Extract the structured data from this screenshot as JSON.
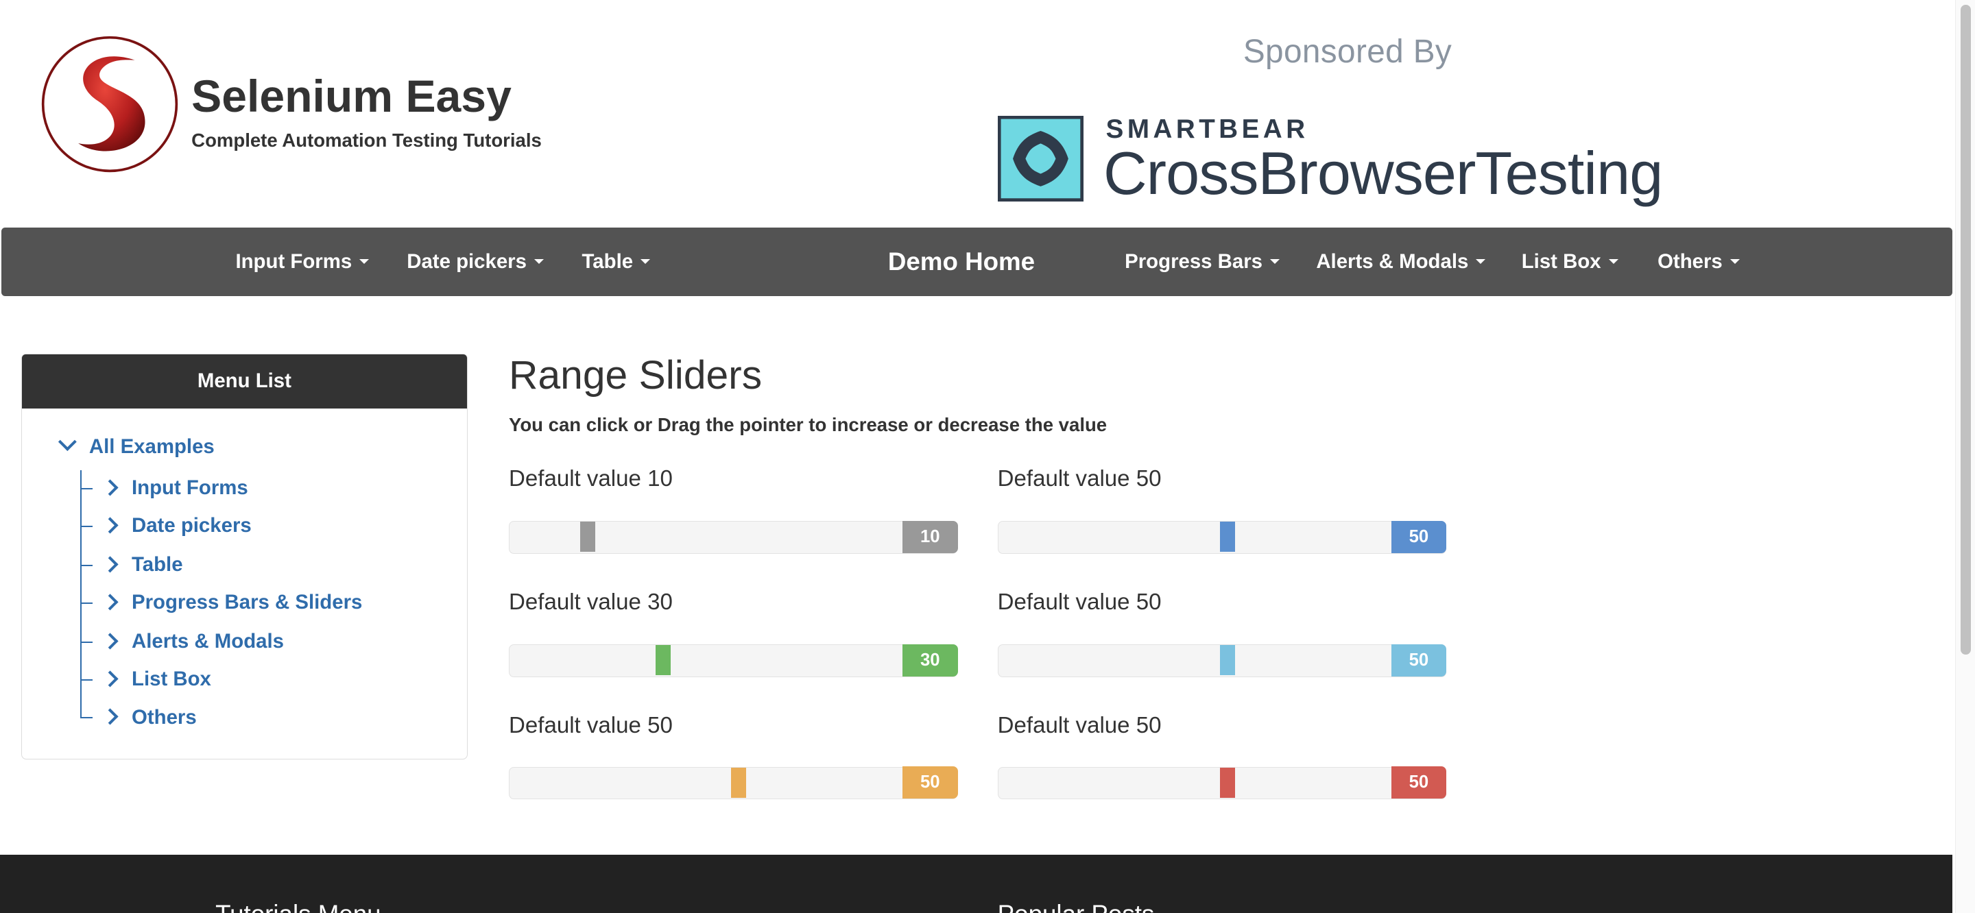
{
  "header": {
    "brand_title": "Selenium Easy",
    "brand_subtitle": "Complete Automation Testing Tutorials",
    "sponsor_label": "Sponsored By",
    "sponsor_top": "SMARTBEAR",
    "sponsor_name": "CrossBrowserTesting"
  },
  "nav": {
    "items_left": [
      "Input Forms",
      "Date pickers",
      "Table"
    ],
    "home": "Demo Home",
    "items_right": [
      "Progress Bars",
      "Alerts & Modals",
      "List Box",
      "Others"
    ]
  },
  "sidebar": {
    "heading": "Menu List",
    "root": "All Examples",
    "items": [
      "Input Forms",
      "Date pickers",
      "Table",
      "Progress Bars & Sliders",
      "Alerts & Modals",
      "List Box",
      "Others"
    ]
  },
  "main": {
    "title": "Range Sliders",
    "description": "You can click or Drag the pointer to increase or decrease the value",
    "sliders": [
      {
        "label": "Default value 10",
        "value": "10",
        "color": "#999999"
      },
      {
        "label": "Default value 50",
        "value": "50",
        "color": "#5b8fcf"
      },
      {
        "label": "Default value 30",
        "value": "30",
        "color": "#6cb860"
      },
      {
        "label": "Default value 50",
        "value": "50",
        "color": "#7bc1df"
      },
      {
        "label": "Default value 50",
        "value": "50",
        "color": "#e9ac55"
      },
      {
        "label": "Default value 50",
        "value": "50",
        "color": "#d25a52"
      }
    ]
  },
  "footer": {
    "col1_heading": "Tutorials Menu",
    "col2_heading": "Popular Posts"
  },
  "colors": {
    "navbar": "#535353",
    "link": "#2f6cab",
    "footer": "#222222"
  }
}
